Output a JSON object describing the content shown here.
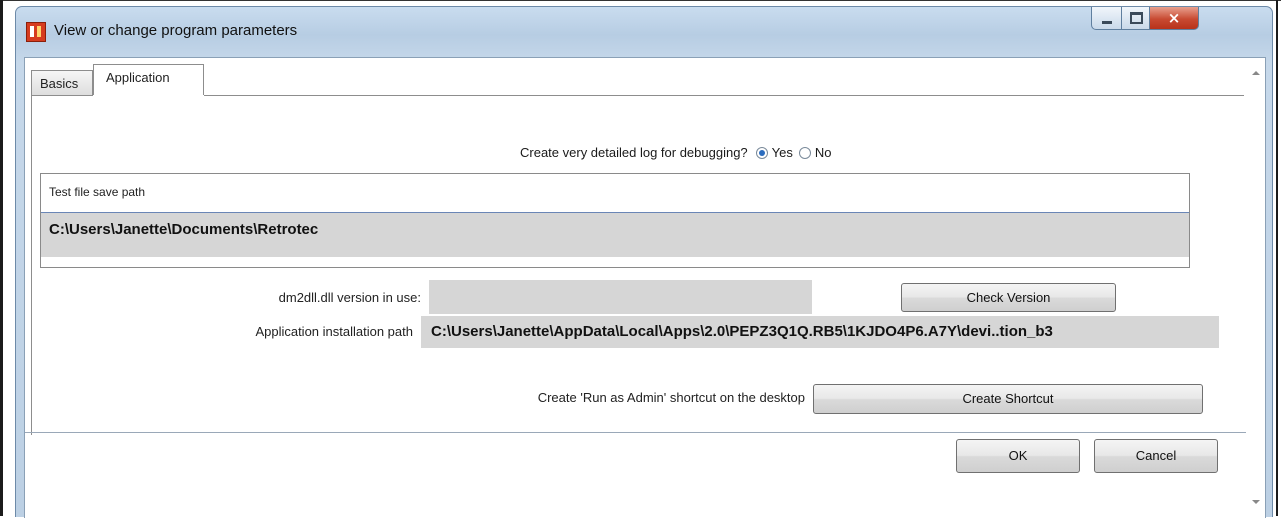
{
  "window": {
    "title": "View or change program parameters",
    "icon": "app-logo-icon",
    "controls": {
      "minimize": "minimize-icon",
      "maximize": "maximize-icon",
      "close": "×"
    }
  },
  "tabs": [
    {
      "label": "Basics",
      "selected": false
    },
    {
      "label": "Application",
      "selected": true
    }
  ],
  "debug_log": {
    "question": "Create very detailed log for debugging?",
    "options": [
      {
        "label": "Yes",
        "selected": true
      },
      {
        "label": "No",
        "selected": false
      }
    ]
  },
  "test_file": {
    "label": "Test file save path",
    "value": "C:\\Users\\Janette\\Documents\\Retrotec"
  },
  "dll_version": {
    "label": "dm2dll.dll version in use:",
    "value": "",
    "button": "Check Version"
  },
  "install_path": {
    "label": "Application installation path",
    "value": "C:\\Users\\Janette\\AppData\\Local\\Apps\\2.0\\PEPZ3Q1Q.RB5\\1KJDO4P6.A7Y\\devi..tion_b3"
  },
  "shortcut": {
    "label": "Create 'Run as Admin' shortcut on the desktop",
    "button": "Create Shortcut"
  },
  "footer": {
    "ok": "OK",
    "cancel": "Cancel"
  },
  "colors": {
    "title_bar": "#c9dcef",
    "close_button": "#c84a32",
    "field_gray": "#d6d6d6",
    "radio_selected": "#2c6dbf"
  }
}
